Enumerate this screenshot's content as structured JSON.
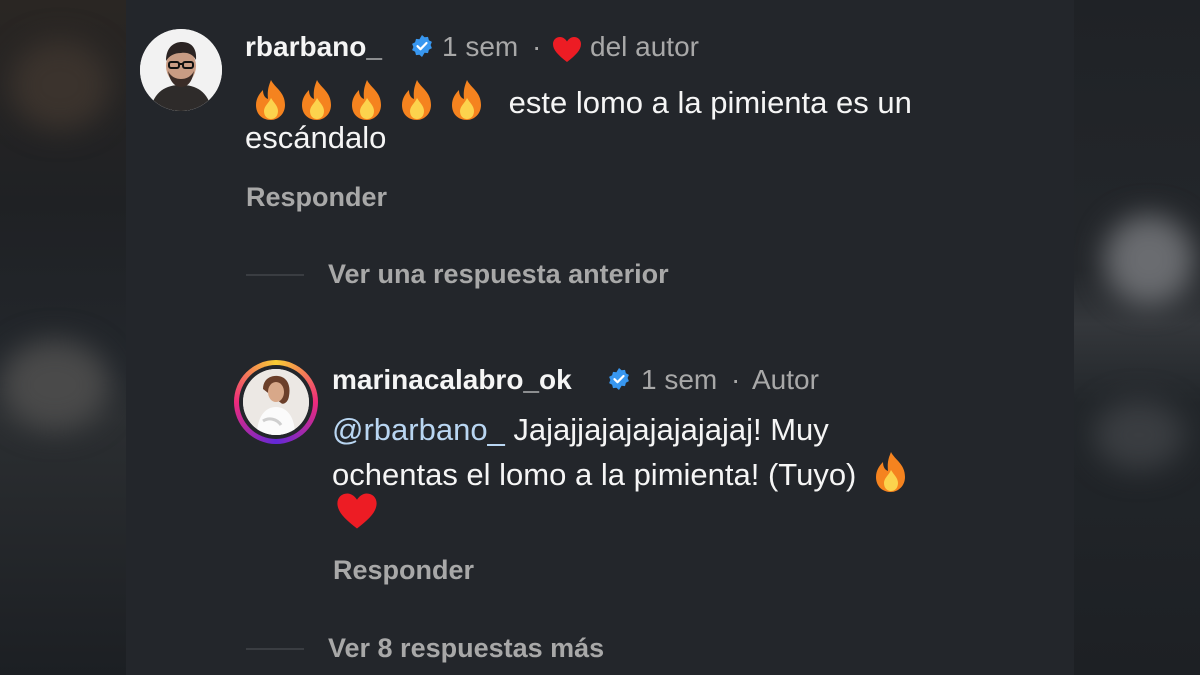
{
  "comment1": {
    "username": "rbarbano_",
    "time": "1 sem",
    "separator": "·",
    "liked_label": "del autor",
    "text_line1": "este lomo a la pimienta es un",
    "text_line2": "escándalo",
    "reply_label": "Responder"
  },
  "view_previous": "Ver una respuesta anterior",
  "comment2": {
    "username": "marinacalabro_ok",
    "time": "1 sem",
    "separator": "·",
    "author_label": "Autor",
    "mention": "@rbarbano_",
    "text_line1_rest": " Jajajjajajajajajajaj! Muy",
    "text_line2": "ochentas el lomo a la pimienta! (Tuyo)",
    "reply_label": "Responder"
  },
  "view_more": "Ver 8 respuestas más",
  "colors": {
    "background": "#23262b",
    "verified": "#3897f0",
    "heart": "#ed1c24",
    "mention": "#b9d6f2"
  },
  "icons": [
    "fire-icon",
    "verified-icon",
    "heart-icon"
  ]
}
